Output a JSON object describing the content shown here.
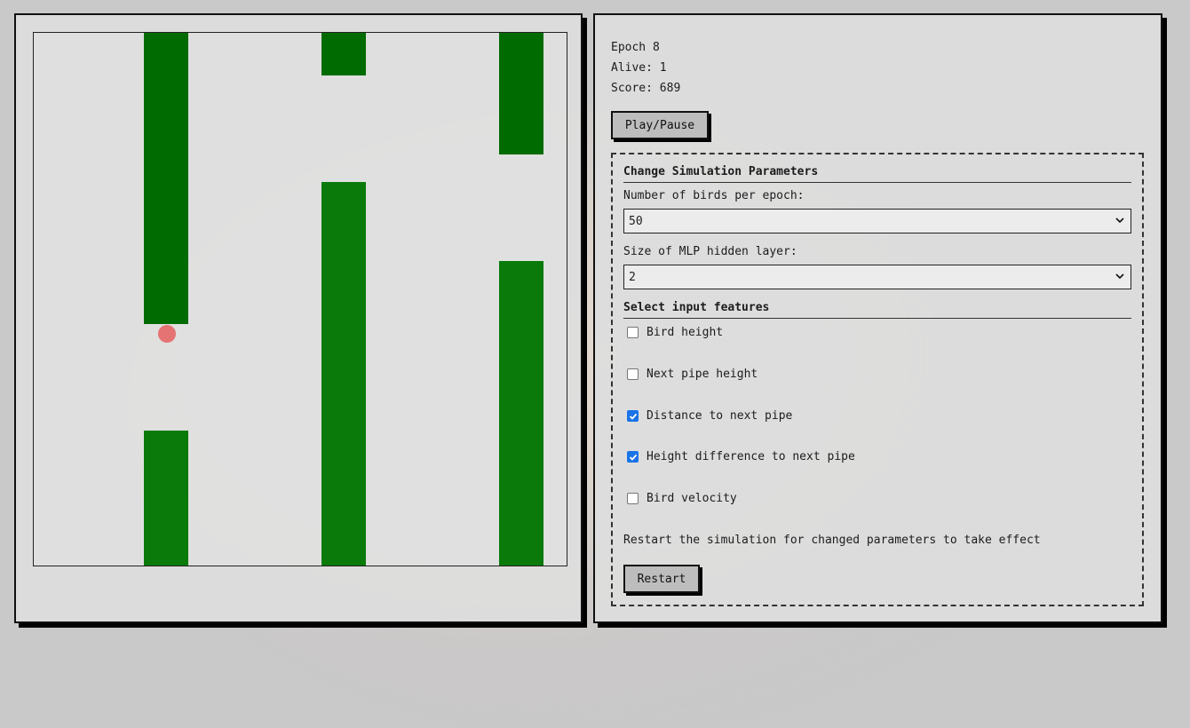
{
  "stats": {
    "epoch": "Epoch 8",
    "alive": "Alive: 1",
    "score": "Score: 689"
  },
  "controls": {
    "play_pause_label": "Play/Pause",
    "restart_label": "Restart"
  },
  "params": {
    "title": "Change Simulation Parameters",
    "birds_label": "Number of birds per epoch:",
    "birds_value": "50",
    "hidden_label": "Size of MLP hidden layer:",
    "hidden_value": "2",
    "features_title": "Select input features",
    "features": [
      {
        "label": "Bird height",
        "checked": false
      },
      {
        "label": "Next pipe height",
        "checked": false
      },
      {
        "label": "Distance to next pipe",
        "checked": true
      },
      {
        "label": "Height difference to next pipe",
        "checked": true
      },
      {
        "label": "Bird velocity",
        "checked": false
      }
    ],
    "note": "Restart the simulation for changed parameters to take effect"
  },
  "colors": {
    "pipe": "#0a7a0a",
    "bird": "#e57373",
    "checkbox_accent": "#1a73e8"
  }
}
